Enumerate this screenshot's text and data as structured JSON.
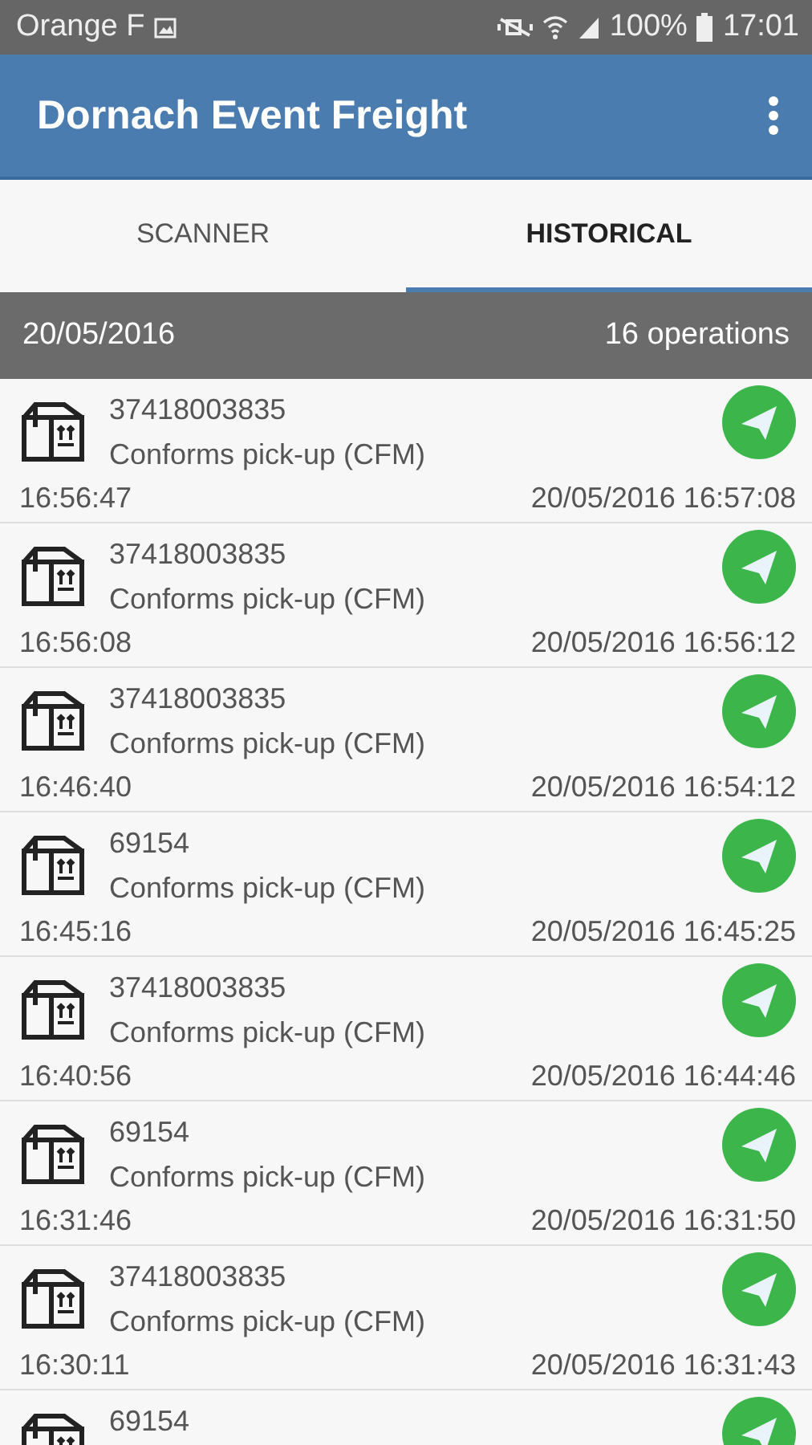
{
  "status_bar": {
    "carrier": "Orange F",
    "battery": "100%",
    "time": "17:01"
  },
  "app_bar": {
    "title": "Dornach Event Freight"
  },
  "tabs": [
    {
      "label": "SCANNER",
      "selected": false
    },
    {
      "label": "HISTORICAL",
      "selected": true
    }
  ],
  "header": {
    "date": "20/05/2016",
    "count": "16 operations"
  },
  "operations": [
    {
      "code": "37418003835",
      "description": "Conforms pick-up (CFM)",
      "time": "16:56:47",
      "sent": "20/05/2016 16:57:08"
    },
    {
      "code": "37418003835",
      "description": "Conforms pick-up (CFM)",
      "time": "16:56:08",
      "sent": "20/05/2016 16:56:12"
    },
    {
      "code": "37418003835",
      "description": "Conforms pick-up (CFM)",
      "time": "16:46:40",
      "sent": "20/05/2016 16:54:12"
    },
    {
      "code": "69154",
      "description": "Conforms pick-up (CFM)",
      "time": "16:45:16",
      "sent": "20/05/2016 16:45:25"
    },
    {
      "code": "37418003835",
      "description": "Conforms pick-up (CFM)",
      "time": "16:40:56",
      "sent": "20/05/2016 16:44:46"
    },
    {
      "code": "69154",
      "description": "Conforms pick-up (CFM)",
      "time": "16:31:46",
      "sent": "20/05/2016 16:31:50"
    },
    {
      "code": "37418003835",
      "description": "Conforms pick-up (CFM)",
      "time": "16:30:11",
      "sent": "20/05/2016 16:31:43"
    },
    {
      "code": "69154"
    }
  ]
}
